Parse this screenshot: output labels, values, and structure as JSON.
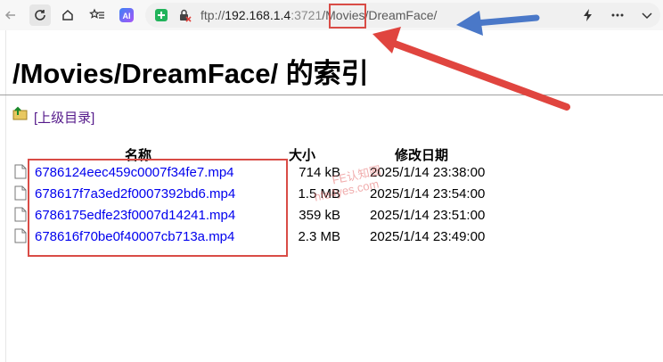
{
  "toolbar": {
    "icons": [
      "back-icon",
      "refresh-icon",
      "home-icon",
      "favorites-icon",
      "ai-icon",
      "extension-icon",
      "blocked-icon",
      "bolt-icon",
      "more-icon",
      "chevron-down-icon"
    ]
  },
  "address_bar": {
    "scheme": "ftp://",
    "host": "192.168.1.4",
    "port": ":3721",
    "sep1": "/",
    "seg1": "Movies",
    "sep2": "/",
    "seg2": "DreamFace/"
  },
  "page": {
    "title": "/Movies/DreamFace/ 的索引",
    "parent_link": "[上级目录]"
  },
  "table": {
    "headers": {
      "name": "名称",
      "size": "大小",
      "modified": "修改日期"
    },
    "rows": [
      {
        "name": "6786124eec459c0007f34fe7.mp4",
        "size": "714 kB",
        "modified": "2025/1/14 23:38:00"
      },
      {
        "name": "678617f7a3ed2f0007392bd6.mp4",
        "size": "1.5 MB",
        "modified": "2025/1/14 23:54:00"
      },
      {
        "name": "6786175edfe23f0007d14241.mp4",
        "size": "359 kB",
        "modified": "2025/1/14 23:51:00"
      },
      {
        "name": "678616f70be0f40007cb713a.mp4",
        "size": "2.3 MB",
        "modified": "2025/1/14 23:49:00"
      }
    ]
  },
  "annotations": {
    "highlight_color": "#d94c46",
    "arrow_red_color": "#e0453f",
    "arrow_blue_color": "#4a78c8"
  },
  "watermark": {
    "line1": "FE认知圈",
    "line2": "hfe4yes.com"
  }
}
